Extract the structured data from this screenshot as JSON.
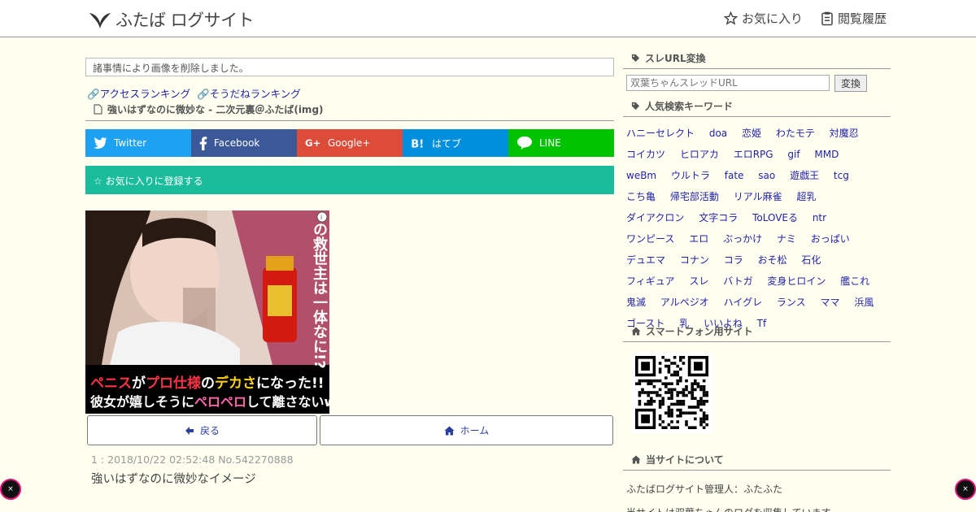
{
  "header": {
    "logo_text": "ふたば ログサイト",
    "nav": [
      {
        "label": "お気に入り",
        "icon": "star-icon"
      },
      {
        "label": "閲覧履歴",
        "icon": "history-icon"
      }
    ]
  },
  "main": {
    "notice": "諸事情により画像を削除しました。",
    "rank_links": [
      "アクセスランキング",
      "そうだねランキング"
    ],
    "thread_title": "強いはずなのに微妙な - 二次元裏＠ふたば(img)",
    "share": [
      {
        "label": "Twitter",
        "color": "#1da1f2"
      },
      {
        "label": "Facebook",
        "color": "#3b5998"
      },
      {
        "label": "Google+",
        "color": "#dd4b39"
      },
      {
        "label": "はてブ",
        "color": "#008fde"
      },
      {
        "label": "LINE",
        "color": "#00c300"
      }
    ],
    "favorite_label": "☆ お気に入りに登録する",
    "ad": {
      "vertical_text": "の救世主は一体なに!?",
      "line1_parts": [
        "ペニス",
        "が",
        "プロ仕様",
        "の",
        "デカさ",
        "になった!!"
      ],
      "line2_parts": [
        "彼女が嬉しそうに",
        "ペロペロ",
        "して離さないw"
      ]
    },
    "back_label": "戻る",
    "home_label": "ホーム",
    "post": {
      "meta": "1 : 2018/10/22 02:52:48 No.542270888",
      "body": "強いはずなのに微妙なイメージ"
    },
    "close_label": "×"
  },
  "sidebar": {
    "url_convert_title": "スレURL変換",
    "url_placeholder": "双葉ちゃんスレッドURL",
    "convert_button": "変換",
    "keywords_title": "人気検索キーワード",
    "keywords": [
      "ハニーセレクト",
      "doa",
      "恋姫",
      "わたモテ",
      "対魔忍",
      "コイカツ",
      "ヒロアカ",
      "エロRPG",
      "gif",
      "MMD",
      "weBm",
      "ウルトラ",
      "fate",
      "sao",
      "遊戯王",
      "tcg",
      "こち亀",
      "帰宅部活動",
      "リアル麻雀",
      "超乳",
      "ダイアクロン",
      "文字コラ",
      "ToLOVEる",
      "ntr",
      "ワンピース",
      "エロ",
      "ぶっかけ",
      "ナミ",
      "おっぱい",
      "デュエマ",
      "コナン",
      "コラ",
      "おそ松",
      "石化",
      "フィギュア",
      "スレ",
      "バトガ",
      "変身ヒロイン",
      "艦これ",
      "鬼滅",
      "アルペジオ",
      "ハイグレ",
      "ランス",
      "ママ",
      "浜風",
      "ゴースト",
      "乳",
      "いいよね",
      "Tf"
    ],
    "smartphone_title": "スマートフォン用サイト",
    "about_title": "当サイトについて",
    "about_lines": [
      "ふたばログサイト管理人：ふたふた",
      "当サイトは双葉ちゃんのログを収集しています。"
    ]
  }
}
